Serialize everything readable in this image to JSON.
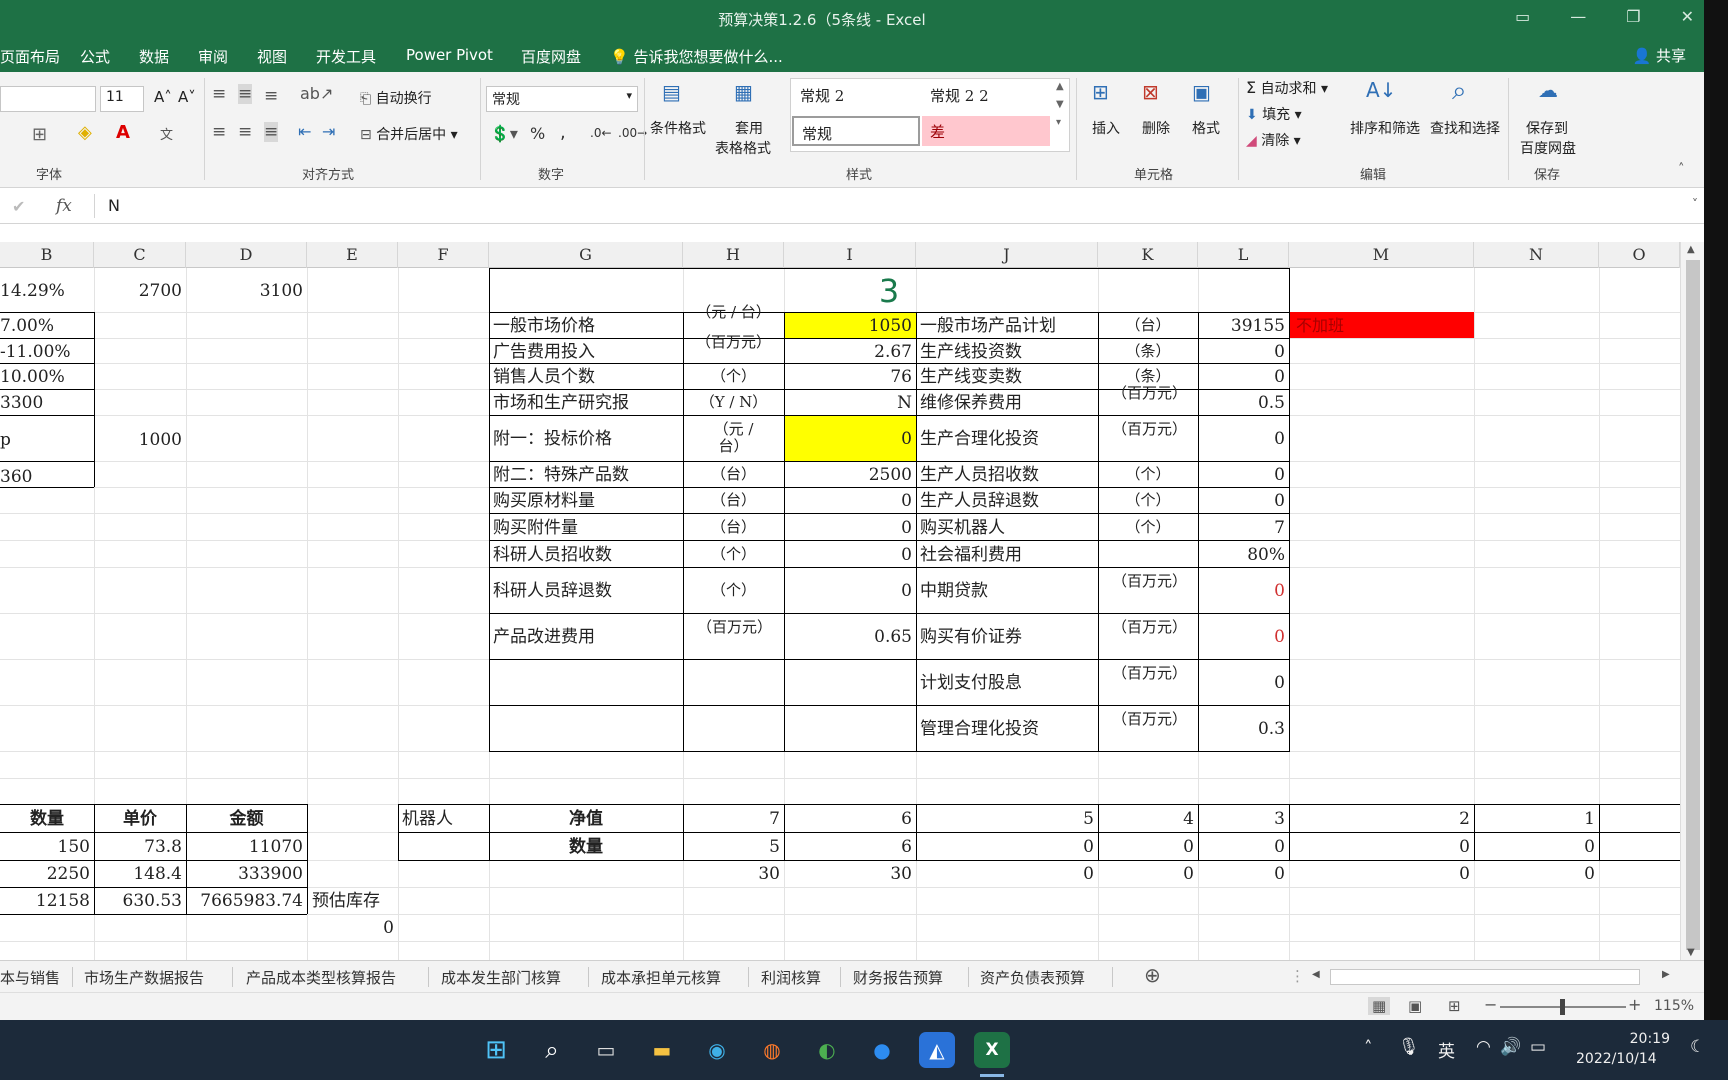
{
  "window": {
    "title": "预算决策1.2.6（5条线 - Excel",
    "ribbon_display_icon": "ribbon-display-icon",
    "minimize_icon": "minimize-icon",
    "restore_icon": "restore-icon",
    "close_icon": "close-icon"
  },
  "menu": {
    "tabs": [
      "页面布局",
      "公式",
      "数据",
      "审阅",
      "视图",
      "开发工具",
      "Power Pivot",
      "百度网盘"
    ],
    "tell_me": "告诉我您想要做什么...",
    "share": "共享"
  },
  "ribbon": {
    "font_size": "11",
    "wrap_text": "自动换行",
    "merge_center": "合并后居中",
    "number_format": "常规",
    "percent": "%",
    "comma": ",",
    "conditional_format": "条件格式",
    "table_format_1": "套用",
    "table_format_2": "表格格式",
    "styles": [
      "常规 2",
      "常规 2 2",
      "常规",
      "差"
    ],
    "insert": "插入",
    "delete": "删除",
    "format": "格式",
    "autosum": "自动求和",
    "fill": "填充",
    "clear": "清除",
    "sort_filter": "排序和筛选",
    "find_select": "查找和选择",
    "save_baidu_1": "保存到",
    "save_baidu_2": "百度网盘",
    "groups": {
      "font": "字体",
      "align": "对齐方式",
      "number": "数字",
      "styles": "样式",
      "cells": "单元格",
      "edit": "编辑",
      "save": "保存"
    }
  },
  "formula_bar": {
    "fx": "fx",
    "value": "N"
  },
  "columns": [
    "B",
    "C",
    "D",
    "E",
    "F",
    "G",
    "H",
    "I",
    "J",
    "K",
    "L",
    "M",
    "N",
    "O"
  ],
  "left_block": {
    "b1": "14.29%",
    "c1": "2700",
    "d1": "3100",
    "b2": "7.00%",
    "b3": "-11.00%",
    "b4": "10.00%",
    "b5": "3300",
    "b6": "p",
    "c6": "1000",
    "b7": "360"
  },
  "decision_table": {
    "title": "3",
    "left_labels": [
      "一般市场价格",
      "广告费用投入",
      "销售人员个数",
      "市场和生产研究报",
      "附一：投标价格",
      "附二：特殊产品数",
      "购买原材料量",
      "购买附件量",
      "科研人员招收数",
      "科研人员辞退数",
      "产品改进费用"
    ],
    "left_units": [
      "（元 / 台）",
      "（百万元）",
      "（个）",
      "（Y / N）",
      "（元 / 台）",
      "（台）",
      "（台）",
      "（台）",
      "（个）",
      "（个）",
      "（百万元）"
    ],
    "left_values": [
      "1050",
      "2.67",
      "76",
      "N",
      "0",
      "2500",
      "0",
      "0",
      "0",
      "0",
      "0.65"
    ],
    "right_labels": [
      "一般市场产品计划",
      "生产线投资数",
      "生产线变卖数",
      "维修保养费用",
      "生产合理化投资",
      "生产人员招收数",
      "生产人员辞退数",
      "购买机器人",
      "社会福利费用",
      "中期贷款",
      "购买有价证券",
      "计划支付股息",
      "管理合理化投资"
    ],
    "right_units": [
      "（台）",
      "（条）",
      "（条）",
      "（百万元）",
      "（百万元）",
      "（个）",
      "（个）",
      "（个）",
      "",
      "（百万元）",
      "（百万元）",
      "（百万元）",
      "（百万元）"
    ],
    "right_values": [
      "39155",
      "0",
      "0",
      "0.5",
      "0",
      "0",
      "0",
      "7",
      "80%",
      "0",
      "0",
      "0",
      "0.3"
    ],
    "m_note": "不加班"
  },
  "bottom_left": {
    "headers": [
      "数量",
      "单价",
      "金额"
    ],
    "rows": [
      [
        "150",
        "73.8",
        "11070"
      ],
      [
        "2250",
        "148.4",
        "333900"
      ],
      [
        "12158",
        "630.53",
        "7665983.74"
      ]
    ],
    "e_label": "预估库存",
    "e_value": "0"
  },
  "robot_table": {
    "label": "机器人",
    "row_labels": [
      "净值",
      "数量"
    ],
    "net_values": [
      "7",
      "6",
      "5",
      "4",
      "3",
      "2",
      "1"
    ],
    "quantities": [
      "5",
      "6",
      "0",
      "0",
      "0",
      "0",
      "0"
    ],
    "third_row": [
      "30",
      "30",
      "0",
      "0",
      "0",
      "0",
      "0"
    ]
  },
  "sheet_tabs": [
    "本与销售",
    "市场生产数据报告",
    "产品成本类型核算报告",
    "成本发生部门核算",
    "成本承担单元核算",
    "利润核算",
    "财务报告预算",
    "资产负债表预算"
  ],
  "status": {
    "zoom": "115%"
  },
  "taskbar": {
    "time": "20:19",
    "date": "2022/10/14",
    "ime": "英",
    "excel_label": "X"
  }
}
